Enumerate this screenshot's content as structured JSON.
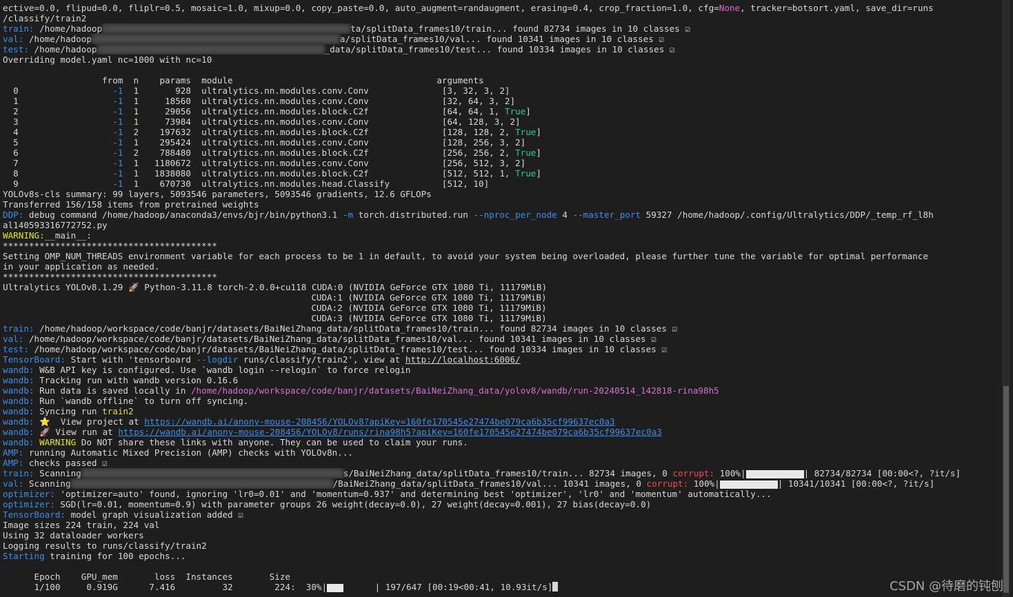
{
  "lines": [
    {
      "segs": [
        {
          "t": "ective=0.0, flipud=0.0, fliplr=0.5, mosaic=1.0, mixup=0.0, copy_paste=0.0, auto_augment=randaugment, erasing=0.4, crop_fraction=1.0, cfg="
        },
        {
          "t": "None",
          "c": "mag"
        },
        {
          "t": ", tracker=botsort.yaml, save_dir=runs"
        }
      ]
    },
    {
      "segs": [
        {
          "t": "/classify/train2"
        }
      ]
    },
    {
      "segs": [
        {
          "t": "train:",
          "c": "blue"
        },
        {
          "t": " /home/hadoop"
        },
        {
          "blur": 360
        },
        {
          "t": "ta/splitData_frames10/train... found 82734 images in 10 classes ☑"
        }
      ]
    },
    {
      "segs": [
        {
          "t": "val:",
          "c": "blue"
        },
        {
          "t": " /home/hadoop"
        },
        {
          "blur": 360
        },
        {
          "t": "a/splitData_frames10/val... found 10341 images in 10 classes ☑"
        }
      ]
    },
    {
      "segs": [
        {
          "t": "test:",
          "c": "blue"
        },
        {
          "t": " /home/hadoop"
        },
        {
          "blur": 330
        },
        {
          "t": "_data/splitData_frames10/test... found 10334 images in 10 classes ☑"
        }
      ]
    },
    {
      "segs": [
        {
          "t": "Overriding model.yaml nc=1000 with nc=10"
        }
      ]
    },
    {
      "segs": [
        {
          "t": ""
        }
      ]
    },
    {
      "segs": [
        {
          "t": "                   from  n    params  module                                       arguments"
        }
      ]
    },
    {
      "segs": [
        {
          "t": "  0                  "
        },
        {
          "t": "-1",
          "c": "blue"
        },
        {
          "t": "  1       928  ultralytics.nn.modules.conv.Conv              [3, 32, 3, 2]"
        }
      ]
    },
    {
      "segs": [
        {
          "t": "  1                  "
        },
        {
          "t": "-1",
          "c": "blue"
        },
        {
          "t": "  1     18560  ultralytics.nn.modules.conv.Conv              [32, 64, 3, 2]"
        }
      ]
    },
    {
      "segs": [
        {
          "t": "  2                  "
        },
        {
          "t": "-1",
          "c": "blue"
        },
        {
          "t": "  1     29056  ultralytics.nn.modules.block.C2f              [64, 64, 1, "
        },
        {
          "t": "True",
          "c": "grn"
        },
        {
          "t": "]"
        }
      ]
    },
    {
      "segs": [
        {
          "t": "  3                  "
        },
        {
          "t": "-1",
          "c": "blue"
        },
        {
          "t": "  1     73984  ultralytics.nn.modules.conv.Conv              [64, 128, 3, 2]"
        }
      ]
    },
    {
      "segs": [
        {
          "t": "  4                  "
        },
        {
          "t": "-1",
          "c": "blue"
        },
        {
          "t": "  2    197632  ultralytics.nn.modules.block.C2f              [128, 128, 2, "
        },
        {
          "t": "True",
          "c": "grn"
        },
        {
          "t": "]"
        }
      ]
    },
    {
      "segs": [
        {
          "t": "  5                  "
        },
        {
          "t": "-1",
          "c": "blue"
        },
        {
          "t": "  1    295424  ultralytics.nn.modules.conv.Conv              [128, 256, 3, 2]"
        }
      ]
    },
    {
      "segs": [
        {
          "t": "  6                  "
        },
        {
          "t": "-1",
          "c": "blue"
        },
        {
          "t": "  2    788480  ultralytics.nn.modules.block.C2f              [256, 256, 2, "
        },
        {
          "t": "True",
          "c": "grn"
        },
        {
          "t": "]"
        }
      ]
    },
    {
      "segs": [
        {
          "t": "  7                  "
        },
        {
          "t": "-1",
          "c": "blue"
        },
        {
          "t": "  1   1180672  ultralytics.nn.modules.conv.Conv              [256, 512, 3, 2]"
        }
      ]
    },
    {
      "segs": [
        {
          "t": "  8                  "
        },
        {
          "t": "-1",
          "c": "blue"
        },
        {
          "t": "  1   1838080  ultralytics.nn.modules.block.C2f              [512, 512, 1, "
        },
        {
          "t": "True",
          "c": "grn"
        },
        {
          "t": "]"
        }
      ]
    },
    {
      "segs": [
        {
          "t": "  9                  "
        },
        {
          "t": "-1",
          "c": "blue"
        },
        {
          "t": "  1    670730  ultralytics.nn.modules.head.Classify          [512, 10]"
        }
      ]
    },
    {
      "segs": [
        {
          "t": "YOLOv8s-cls summary: 99 layers, 5093546 parameters, 5093546 gradients, 12.6 GFLOPs"
        }
      ]
    },
    {
      "segs": [
        {
          "t": "Transferred 156/158 items from pretrained weights"
        }
      ]
    },
    {
      "segs": [
        {
          "t": "DDP:",
          "c": "blue"
        },
        {
          "t": " debug command /home/hadoop/anaconda3/envs/bjr/bin/python3.1 "
        },
        {
          "t": "-m",
          "c": "blue"
        },
        {
          "t": " torch.distributed.run "
        },
        {
          "t": "--nproc_per_node",
          "c": "blue"
        },
        {
          "t": " 4 "
        },
        {
          "t": "--master_port",
          "c": "blue"
        },
        {
          "t": " 59327 /home/hadoop/.config/Ultralytics/DDP/_temp_rf_l8h"
        }
      ]
    },
    {
      "segs": [
        {
          "t": "al140593316772752.py"
        }
      ]
    },
    {
      "segs": [
        {
          "t": "WARNING:",
          "c": "yel"
        },
        {
          "t": "__main__:"
        }
      ]
    },
    {
      "segs": [
        {
          "t": "*****************************************"
        }
      ]
    },
    {
      "segs": [
        {
          "t": "Setting OMP_NUM_THREADS environment variable for each process to be 1 in default, to avoid your system being overloaded, please further tune the variable for optimal performance"
        }
      ]
    },
    {
      "segs": [
        {
          "t": "in your application as needed."
        }
      ]
    },
    {
      "segs": [
        {
          "t": "*****************************************"
        }
      ]
    },
    {
      "segs": [
        {
          "t": "Ultralytics YOLOv8.1.29 🚀 Python-3.11.8 torch-2.0.0+cu118 CUDA:0 (NVIDIA GeForce GTX 1080 Ti, 11179MiB)"
        }
      ]
    },
    {
      "segs": [
        {
          "t": "                                                           CUDA:1 (NVIDIA GeForce GTX 1080 Ti, 11179MiB)"
        }
      ]
    },
    {
      "segs": [
        {
          "t": "                                                           CUDA:2 (NVIDIA GeForce GTX 1080 Ti, 11179MiB)"
        }
      ]
    },
    {
      "segs": [
        {
          "t": "                                                           CUDA:3 (NVIDIA GeForce GTX 1080 Ti, 11179MiB)"
        }
      ]
    },
    {
      "segs": [
        {
          "t": "train:",
          "c": "blue"
        },
        {
          "t": " /home/hadoop/workspace/code/banjr/datasets/BaiNeiZhang_data/splitData_frames10/train... found 82734 images in 10 classes ☑"
        }
      ]
    },
    {
      "segs": [
        {
          "t": "val:",
          "c": "blue"
        },
        {
          "t": " /home/hadoop/workspace/code/banjr/datasets/BaiNeiZhang_data/splitData_frames10/val... found 10341 images in 10 classes ☑"
        }
      ]
    },
    {
      "segs": [
        {
          "t": "test:",
          "c": "blue"
        },
        {
          "t": " /home/hadoop/workspace/code/banjr/datasets/BaiNeiZhang_data/splitData_frames10/test... found 10334 images in 10 classes ☑"
        }
      ]
    },
    {
      "segs": [
        {
          "t": "TensorBoard:",
          "c": "blue"
        },
        {
          "t": " Start with 'tensorboard "
        },
        {
          "t": "--logdir",
          "c": "blue"
        },
        {
          "t": " runs/classify/train2', view at "
        },
        {
          "t": "http://localhost:6006/",
          "c": "plainlink"
        }
      ]
    },
    {
      "segs": [
        {
          "t": "wandb:",
          "c": "blue"
        },
        {
          "t": " W&B API key is configured. Use `wandb login --relogin` to force relogin"
        }
      ]
    },
    {
      "segs": [
        {
          "t": "wandb:",
          "c": "blue"
        },
        {
          "t": " Tracking run with wandb version 0.16.6"
        }
      ]
    },
    {
      "segs": [
        {
          "t": "wandb:",
          "c": "blue"
        },
        {
          "t": " Run data is saved locally in "
        },
        {
          "t": "/home/hadoop/workspace/code/banjr/datasets/BaiNeiZhang_data/yolov8/wandb/run-20240514_142818-rina98h5",
          "c": "mag"
        }
      ]
    },
    {
      "segs": [
        {
          "t": "wandb:",
          "c": "blue"
        },
        {
          "t": " Run `wandb offline` to turn off syncing."
        }
      ]
    },
    {
      "segs": [
        {
          "t": "wandb:",
          "c": "blue"
        },
        {
          "t": " Syncing run "
        },
        {
          "t": "train2",
          "c": "ora"
        }
      ]
    },
    {
      "segs": [
        {
          "t": "wandb:",
          "c": "blue"
        },
        {
          "t": " ⭐  View project at "
        },
        {
          "t": "https://wandb.ai/anony-mouse-208456/YOLOv8?apiKey=160fe170545e27474be079ca6b35cf99637ec0a3",
          "c": "link"
        }
      ]
    },
    {
      "segs": [
        {
          "t": "wandb:",
          "c": "blue"
        },
        {
          "t": " 🚀 View run at "
        },
        {
          "t": "https://wandb.ai/anony-mouse-208456/YOLOv8/runs/rina98h5?apiKey=160fe170545e27474be079ca6b35cf99637ec0a3",
          "c": "link"
        }
      ]
    },
    {
      "segs": [
        {
          "t": "wandb:",
          "c": "blue"
        },
        {
          "t": " "
        },
        {
          "t": "WARNING",
          "c": "yel"
        },
        {
          "t": " Do NOT share these links with anyone. They can be used to claim your runs."
        }
      ]
    },
    {
      "segs": [
        {
          "t": "AMP:",
          "c": "blue"
        },
        {
          "t": " running Automatic Mixed Precision (AMP) checks with YOLOv8n..."
        }
      ]
    },
    {
      "segs": [
        {
          "t": "AMP:",
          "c": "blue"
        },
        {
          "t": " checks passed ☑"
        }
      ]
    },
    {
      "segs": [
        {
          "t": "train:",
          "c": "blue"
        },
        {
          "t": " Scanning"
        },
        {
          "blur": 380
        },
        {
          "t": "s/BaiNeiZhang_data/splitData_frames10/train... 82734 images, 0 "
        },
        {
          "t": "corrupt:",
          "c": "red"
        },
        {
          "t": " 100%|"
        },
        {
          "fill": 84
        },
        {
          "t": "| 82734/82734 [00:00<?, ?it/s]"
        }
      ]
    },
    {
      "segs": [
        {
          "t": "val:",
          "c": "blue"
        },
        {
          "t": " Scanning"
        },
        {
          "blur": 380
        },
        {
          "t": "/BaiNeiZhang_data/splitData_frames10/val... 10341 images, 0 "
        },
        {
          "t": "corrupt:",
          "c": "red"
        },
        {
          "t": " 100%|"
        },
        {
          "fill": 84
        },
        {
          "t": "| 10341/10341 [00:00<?, ?it/s]"
        }
      ]
    },
    {
      "segs": [
        {
          "t": "optimizer:",
          "c": "blue"
        },
        {
          "t": " 'optimizer=auto' found, ignoring 'lr0=0.01' and 'momentum=0.937' and determining best 'optimizer', 'lr0' and 'momentum' automatically..."
        }
      ]
    },
    {
      "segs": [
        {
          "t": "optimizer:",
          "c": "blue"
        },
        {
          "t": " SGD(lr=0.01, momentum=0.9) with parameter groups 26 weight(decay=0.0), 27 weight(decay=0.001), 27 bias(decay=0.0)"
        }
      ]
    },
    {
      "segs": [
        {
          "t": "TensorBoard:",
          "c": "blue"
        },
        {
          "t": " model graph visualization added ☑"
        }
      ]
    },
    {
      "segs": [
        {
          "t": "Image sizes 224 train, 224 val"
        }
      ]
    },
    {
      "segs": [
        {
          "t": "Using 32 dataloader workers"
        }
      ]
    },
    {
      "segs": [
        {
          "t": "Logging results to runs/classify/train2"
        }
      ]
    },
    {
      "segs": [
        {
          "t": "Starting",
          "c": "blue"
        },
        {
          "t": " training for 100 epochs..."
        }
      ]
    },
    {
      "segs": [
        {
          "t": ""
        }
      ]
    },
    {
      "segs": [
        {
          "t": "      Epoch    GPU_mem       loss  Instances       Size"
        }
      ]
    },
    {
      "segs": [
        {
          "t": "      1/100     0.919G      7.416         32        224:  30%|"
        },
        {
          "fill": 24
        },
        {
          "t": "      | 197/647 [00:19<00:41, 10.93it/s]"
        },
        {
          "cursor": true
        }
      ]
    }
  ],
  "watermark": "CSDN @待磨的钝刨",
  "progress": {
    "fraction": 0.3
  }
}
